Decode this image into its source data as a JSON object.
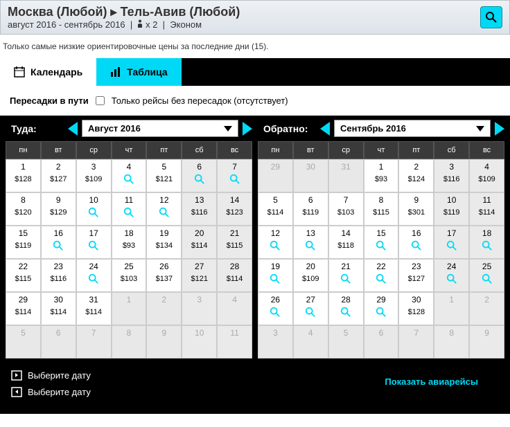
{
  "header": {
    "title": "Москва (Любой) ▸ Тель-Авив (Любой)",
    "dates": "август 2016 - сентябрь 2016",
    "pax": "x 2",
    "class": "Эконом"
  },
  "note": "Только самые низкие ориентировочные цены за последние дни (15).",
  "tabs": {
    "cal": "Календарь",
    "tbl": "Таблица"
  },
  "filter": {
    "label": "Пересадки в пути",
    "opt": "Только рейсы без пересадок (отсутствует)"
  },
  "out": {
    "label": "Туда:",
    "month": "Август 2016",
    "dow": [
      "пн",
      "вт",
      "ср",
      "чт",
      "пт",
      "сб",
      "вс"
    ],
    "cells": [
      {
        "d": "1",
        "p": "$128"
      },
      {
        "d": "2",
        "p": "$127"
      },
      {
        "d": "3",
        "p": "$109"
      },
      {
        "d": "4",
        "s": true
      },
      {
        "d": "5",
        "p": "$121"
      },
      {
        "d": "6",
        "s": true,
        "w": true
      },
      {
        "d": "7",
        "s": true,
        "w": true
      },
      {
        "d": "8",
        "p": "$120"
      },
      {
        "d": "9",
        "p": "$129"
      },
      {
        "d": "10",
        "s": true
      },
      {
        "d": "11",
        "s": true
      },
      {
        "d": "12",
        "s": true
      },
      {
        "d": "13",
        "p": "$116",
        "w": true
      },
      {
        "d": "14",
        "p": "$123",
        "w": true
      },
      {
        "d": "15",
        "p": "$119"
      },
      {
        "d": "16",
        "s": true
      },
      {
        "d": "17",
        "s": true
      },
      {
        "d": "18",
        "p": "$93"
      },
      {
        "d": "19",
        "p": "$134"
      },
      {
        "d": "20",
        "p": "$114",
        "w": true
      },
      {
        "d": "21",
        "p": "$115",
        "w": true
      },
      {
        "d": "22",
        "p": "$115"
      },
      {
        "d": "23",
        "p": "$116"
      },
      {
        "d": "24",
        "s": true
      },
      {
        "d": "25",
        "p": "$103"
      },
      {
        "d": "26",
        "p": "$137"
      },
      {
        "d": "27",
        "p": "$121",
        "w": true
      },
      {
        "d": "28",
        "p": "$114",
        "w": true
      },
      {
        "d": "29",
        "p": "$114"
      },
      {
        "d": "30",
        "p": "$114"
      },
      {
        "d": "31",
        "p": "$114"
      },
      {
        "d": "1",
        "dim": true
      },
      {
        "d": "2",
        "dim": true
      },
      {
        "d": "3",
        "dim": true,
        "w": true
      },
      {
        "d": "4",
        "dim": true,
        "w": true
      },
      {
        "d": "5",
        "dim": true
      },
      {
        "d": "6",
        "dim": true
      },
      {
        "d": "7",
        "dim": true
      },
      {
        "d": "8",
        "dim": true
      },
      {
        "d": "9",
        "dim": true
      },
      {
        "d": "10",
        "dim": true,
        "w": true
      },
      {
        "d": "11",
        "dim": true,
        "w": true
      }
    ]
  },
  "ret": {
    "label": "Обратно:",
    "month": "Сентябрь 2016",
    "dow": [
      "пн",
      "вт",
      "ср",
      "чт",
      "пт",
      "сб",
      "вс"
    ],
    "cells": [
      {
        "d": "29",
        "dim": true
      },
      {
        "d": "30",
        "dim": true
      },
      {
        "d": "31",
        "dim": true
      },
      {
        "d": "1",
        "p": "$93"
      },
      {
        "d": "2",
        "p": "$124"
      },
      {
        "d": "3",
        "p": "$116",
        "w": true
      },
      {
        "d": "4",
        "p": "$109",
        "w": true
      },
      {
        "d": "5",
        "p": "$114"
      },
      {
        "d": "6",
        "p": "$119"
      },
      {
        "d": "7",
        "p": "$103"
      },
      {
        "d": "8",
        "p": "$115"
      },
      {
        "d": "9",
        "p": "$301"
      },
      {
        "d": "10",
        "p": "$119",
        "w": true
      },
      {
        "d": "11",
        "p": "$114",
        "w": true
      },
      {
        "d": "12",
        "s": true
      },
      {
        "d": "13",
        "s": true
      },
      {
        "d": "14",
        "p": "$118"
      },
      {
        "d": "15",
        "s": true
      },
      {
        "d": "16",
        "s": true
      },
      {
        "d": "17",
        "s": true,
        "w": true
      },
      {
        "d": "18",
        "s": true,
        "w": true
      },
      {
        "d": "19",
        "s": true
      },
      {
        "d": "20",
        "p": "$109"
      },
      {
        "d": "21",
        "s": true
      },
      {
        "d": "22",
        "s": true
      },
      {
        "d": "23",
        "p": "$127"
      },
      {
        "d": "24",
        "s": true,
        "w": true
      },
      {
        "d": "25",
        "s": true,
        "w": true
      },
      {
        "d": "26",
        "s": true
      },
      {
        "d": "27",
        "s": true
      },
      {
        "d": "28",
        "s": true
      },
      {
        "d": "29",
        "s": true
      },
      {
        "d": "30",
        "p": "$128"
      },
      {
        "d": "1",
        "dim": true,
        "w": true
      },
      {
        "d": "2",
        "dim": true,
        "w": true
      },
      {
        "d": "3",
        "dim": true
      },
      {
        "d": "4",
        "dim": true
      },
      {
        "d": "5",
        "dim": true
      },
      {
        "d": "6",
        "dim": true
      },
      {
        "d": "7",
        "dim": true
      },
      {
        "d": "8",
        "dim": true,
        "w": true
      },
      {
        "d": "9",
        "dim": true,
        "w": true
      }
    ]
  },
  "footer": {
    "select": "Выберите дату",
    "show": "Показать авиарейсы"
  }
}
